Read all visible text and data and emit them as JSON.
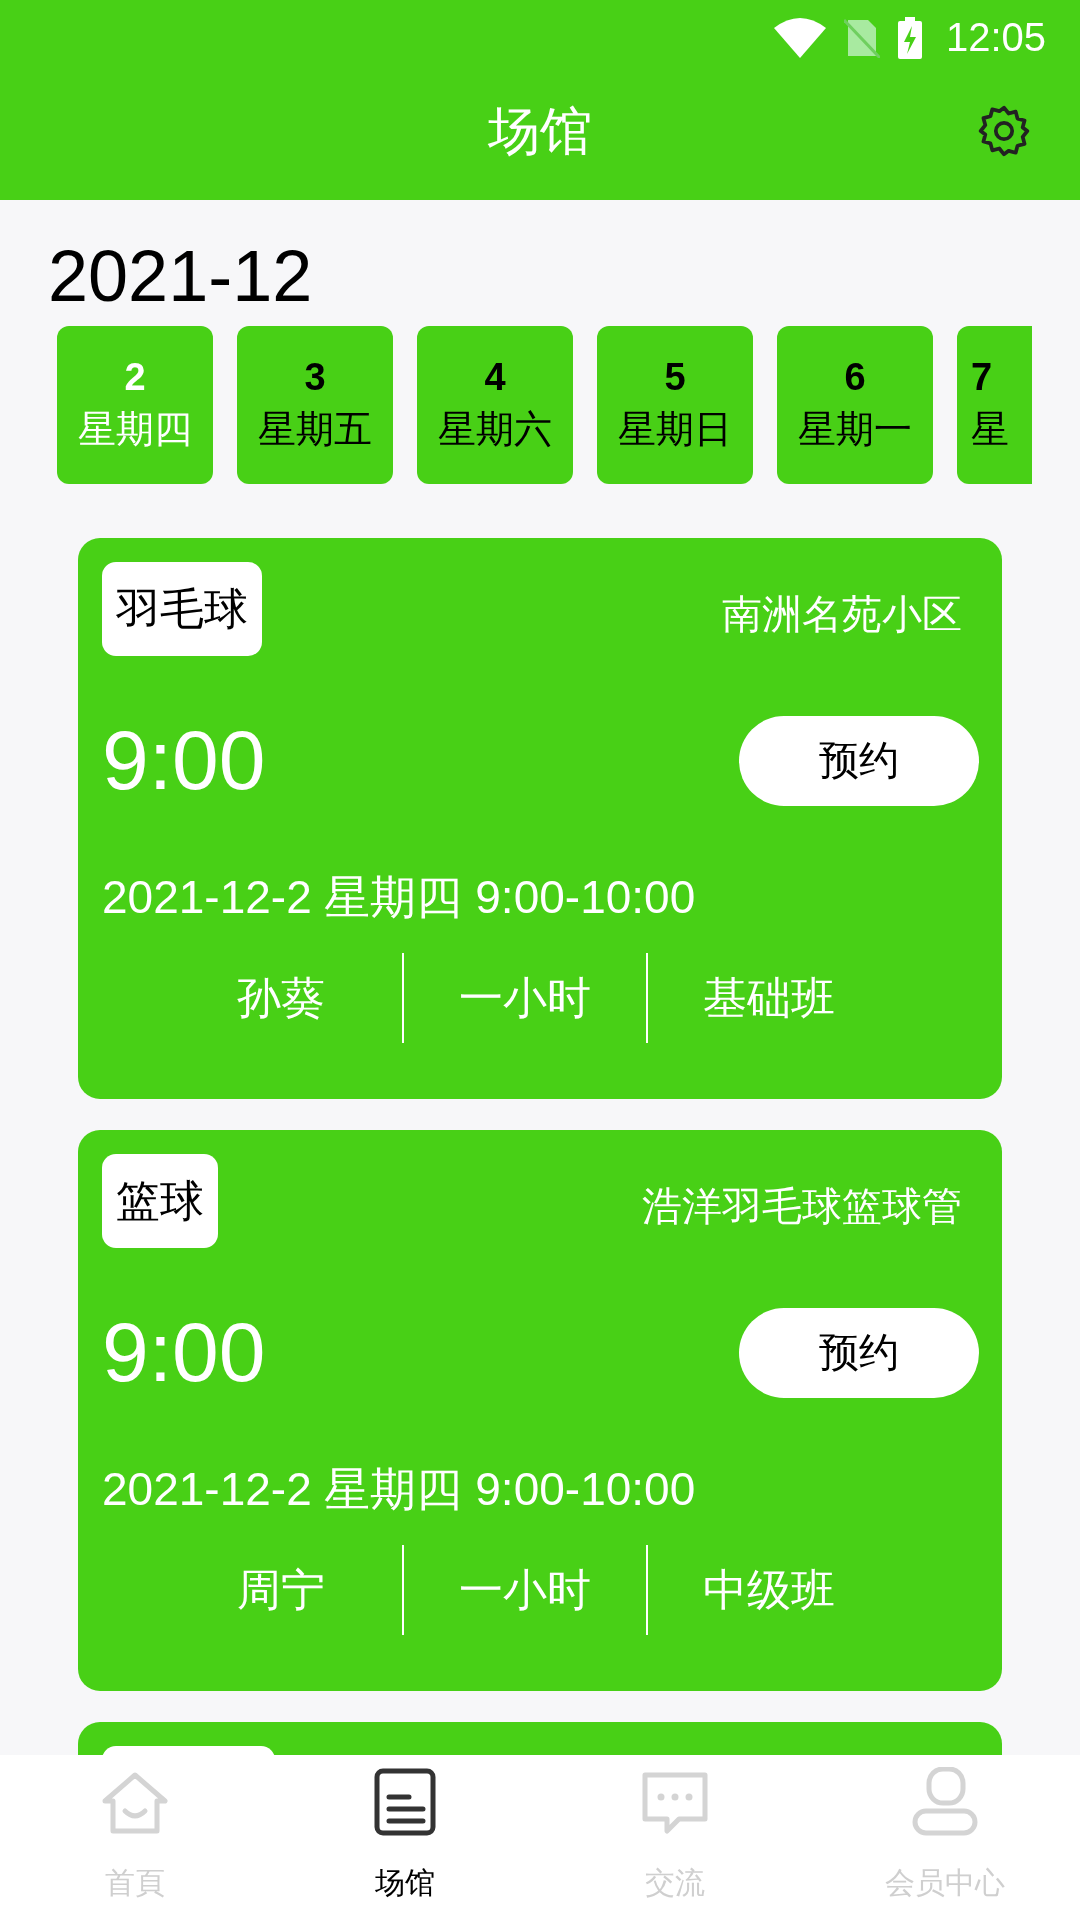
{
  "status_bar": {
    "time": "12:05"
  },
  "header": {
    "title": "场馆"
  },
  "month": "2021-12",
  "dates": [
    {
      "day": "2",
      "weekday": "星期四",
      "selected": true,
      "kind": "full"
    },
    {
      "day": "3",
      "weekday": "星期五",
      "selected": false,
      "kind": "full"
    },
    {
      "day": "4",
      "weekday": "星期六",
      "selected": false,
      "kind": "full"
    },
    {
      "day": "5",
      "weekday": "星期日",
      "selected": false,
      "kind": "full"
    },
    {
      "day": "6",
      "weekday": "星期一",
      "selected": false,
      "kind": "full"
    },
    {
      "day": "7",
      "weekday": "星",
      "selected": false,
      "kind": "partial"
    }
  ],
  "cards": [
    {
      "kind": "full",
      "sport": "羽毛球",
      "venue": "南洲名苑小区",
      "time": "9:00",
      "button": "预约",
      "schedule": "2021-12-2 星期四 9:00-10:00",
      "coach": "孙葵",
      "duration": "一小时",
      "level": "基础班"
    },
    {
      "kind": "full",
      "sport": "篮球",
      "venue": "浩洋羽毛球篮球管",
      "time": "9:00",
      "button": "预约",
      "schedule": "2021-12-2 星期四 9:00-10:00",
      "coach": "周宁",
      "duration": "一小时",
      "level": "中级班"
    },
    {
      "kind": "partial"
    }
  ],
  "nav": [
    {
      "label": "首頁",
      "kind": "home",
      "selected": false
    },
    {
      "label": "场馆",
      "kind": "doc",
      "selected": true
    },
    {
      "label": "交流",
      "kind": "chat",
      "selected": false
    },
    {
      "label": "会员中心",
      "kind": "user",
      "selected": false
    }
  ]
}
